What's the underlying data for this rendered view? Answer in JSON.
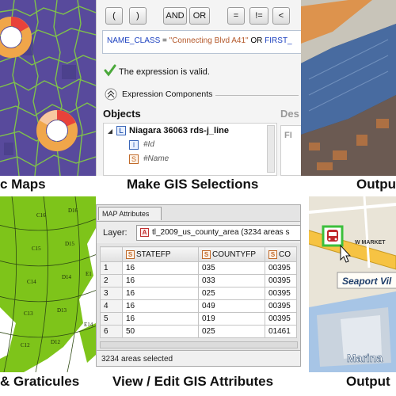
{
  "captions": {
    "thematic_maps": "c Maps",
    "make_selections": "Make GIS Selections",
    "output_top": "Outpu",
    "graticules": "& Graticules",
    "view_edit_attributes": "View / Edit GIS Attributes",
    "output_bottom": "Output"
  },
  "expression_builder": {
    "toolbar_buttons": [
      "(",
      ")",
      "AND",
      "OR",
      "=",
      "!=",
      "<"
    ],
    "expression_field": "NAME_CLASS",
    "expression_operator": "=",
    "expression_value": "\"Connecting Blvd A41\"",
    "expression_conjunction": "OR",
    "expression_tail": "FIRST_",
    "valid_message": "The expression is valid.",
    "components_label": "Expression Components",
    "objects_label": "Objects",
    "description_label": "Des",
    "tree_root": "Niagara 36063 rds-j_line",
    "tree_field_1": "#Id",
    "tree_field_2": "#Name",
    "right_snippet": "FI"
  },
  "attributes": {
    "tab_title": "MAP Attributes",
    "layer_label": "Layer:",
    "layer_value": "tl_2009_us_county_area (3234 areas s",
    "columns": [
      "STATEFP",
      "COUNTYFP",
      "CO"
    ],
    "rows": [
      {
        "n": "1",
        "statefp": "16",
        "countyfp": "035",
        "co": "00395"
      },
      {
        "n": "2",
        "statefp": "16",
        "countyfp": "033",
        "co": "00395"
      },
      {
        "n": "3",
        "statefp": "16",
        "countyfp": "025",
        "co": "00395"
      },
      {
        "n": "4",
        "statefp": "16",
        "countyfp": "049",
        "co": "00395"
      },
      {
        "n": "5",
        "statefp": "16",
        "countyfp": "019",
        "co": "00395"
      },
      {
        "n": "6",
        "statefp": "50",
        "countyfp": "025",
        "co": "01461"
      }
    ],
    "status": "3234 areas selected"
  },
  "graticules_map": {
    "labels": [
      "C16",
      "D16",
      "C15",
      "D15",
      "C14",
      "D14",
      "C13",
      "D13",
      "C12",
      "D12",
      "E14",
      "E1"
    ]
  },
  "output_map": {
    "street_label": "W MARKET",
    "place_label": "Seaport Vil",
    "area_label": "Marina"
  }
}
